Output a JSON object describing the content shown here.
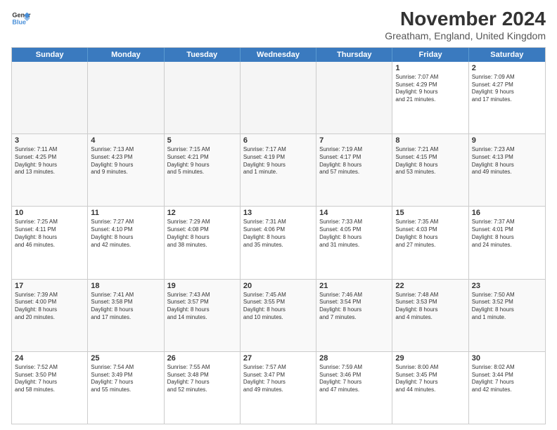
{
  "header": {
    "logo_line1": "General",
    "logo_line2": "Blue",
    "main_title": "November 2024",
    "subtitle": "Greatham, England, United Kingdom"
  },
  "weekdays": [
    "Sunday",
    "Monday",
    "Tuesday",
    "Wednesday",
    "Thursday",
    "Friday",
    "Saturday"
  ],
  "rows": [
    [
      {
        "day": "",
        "info": "",
        "empty": true
      },
      {
        "day": "",
        "info": "",
        "empty": true
      },
      {
        "day": "",
        "info": "",
        "empty": true
      },
      {
        "day": "",
        "info": "",
        "empty": true
      },
      {
        "day": "",
        "info": "",
        "empty": true
      },
      {
        "day": "1",
        "info": "Sunrise: 7:07 AM\nSunset: 4:29 PM\nDaylight: 9 hours\nand 21 minutes.",
        "empty": false
      },
      {
        "day": "2",
        "info": "Sunrise: 7:09 AM\nSunset: 4:27 PM\nDaylight: 9 hours\nand 17 minutes.",
        "empty": false
      }
    ],
    [
      {
        "day": "3",
        "info": "Sunrise: 7:11 AM\nSunset: 4:25 PM\nDaylight: 9 hours\nand 13 minutes.",
        "empty": false
      },
      {
        "day": "4",
        "info": "Sunrise: 7:13 AM\nSunset: 4:23 PM\nDaylight: 9 hours\nand 9 minutes.",
        "empty": false
      },
      {
        "day": "5",
        "info": "Sunrise: 7:15 AM\nSunset: 4:21 PM\nDaylight: 9 hours\nand 5 minutes.",
        "empty": false
      },
      {
        "day": "6",
        "info": "Sunrise: 7:17 AM\nSunset: 4:19 PM\nDaylight: 9 hours\nand 1 minute.",
        "empty": false
      },
      {
        "day": "7",
        "info": "Sunrise: 7:19 AM\nSunset: 4:17 PM\nDaylight: 8 hours\nand 57 minutes.",
        "empty": false
      },
      {
        "day": "8",
        "info": "Sunrise: 7:21 AM\nSunset: 4:15 PM\nDaylight: 8 hours\nand 53 minutes.",
        "empty": false
      },
      {
        "day": "9",
        "info": "Sunrise: 7:23 AM\nSunset: 4:13 PM\nDaylight: 8 hours\nand 49 minutes.",
        "empty": false
      }
    ],
    [
      {
        "day": "10",
        "info": "Sunrise: 7:25 AM\nSunset: 4:11 PM\nDaylight: 8 hours\nand 46 minutes.",
        "empty": false
      },
      {
        "day": "11",
        "info": "Sunrise: 7:27 AM\nSunset: 4:10 PM\nDaylight: 8 hours\nand 42 minutes.",
        "empty": false
      },
      {
        "day": "12",
        "info": "Sunrise: 7:29 AM\nSunset: 4:08 PM\nDaylight: 8 hours\nand 38 minutes.",
        "empty": false
      },
      {
        "day": "13",
        "info": "Sunrise: 7:31 AM\nSunset: 4:06 PM\nDaylight: 8 hours\nand 35 minutes.",
        "empty": false
      },
      {
        "day": "14",
        "info": "Sunrise: 7:33 AM\nSunset: 4:05 PM\nDaylight: 8 hours\nand 31 minutes.",
        "empty": false
      },
      {
        "day": "15",
        "info": "Sunrise: 7:35 AM\nSunset: 4:03 PM\nDaylight: 8 hours\nand 27 minutes.",
        "empty": false
      },
      {
        "day": "16",
        "info": "Sunrise: 7:37 AM\nSunset: 4:01 PM\nDaylight: 8 hours\nand 24 minutes.",
        "empty": false
      }
    ],
    [
      {
        "day": "17",
        "info": "Sunrise: 7:39 AM\nSunset: 4:00 PM\nDaylight: 8 hours\nand 20 minutes.",
        "empty": false
      },
      {
        "day": "18",
        "info": "Sunrise: 7:41 AM\nSunset: 3:58 PM\nDaylight: 8 hours\nand 17 minutes.",
        "empty": false
      },
      {
        "day": "19",
        "info": "Sunrise: 7:43 AM\nSunset: 3:57 PM\nDaylight: 8 hours\nand 14 minutes.",
        "empty": false
      },
      {
        "day": "20",
        "info": "Sunrise: 7:45 AM\nSunset: 3:55 PM\nDaylight: 8 hours\nand 10 minutes.",
        "empty": false
      },
      {
        "day": "21",
        "info": "Sunrise: 7:46 AM\nSunset: 3:54 PM\nDaylight: 8 hours\nand 7 minutes.",
        "empty": false
      },
      {
        "day": "22",
        "info": "Sunrise: 7:48 AM\nSunset: 3:53 PM\nDaylight: 8 hours\nand 4 minutes.",
        "empty": false
      },
      {
        "day": "23",
        "info": "Sunrise: 7:50 AM\nSunset: 3:52 PM\nDaylight: 8 hours\nand 1 minute.",
        "empty": false
      }
    ],
    [
      {
        "day": "24",
        "info": "Sunrise: 7:52 AM\nSunset: 3:50 PM\nDaylight: 7 hours\nand 58 minutes.",
        "empty": false
      },
      {
        "day": "25",
        "info": "Sunrise: 7:54 AM\nSunset: 3:49 PM\nDaylight: 7 hours\nand 55 minutes.",
        "empty": false
      },
      {
        "day": "26",
        "info": "Sunrise: 7:55 AM\nSunset: 3:48 PM\nDaylight: 7 hours\nand 52 minutes.",
        "empty": false
      },
      {
        "day": "27",
        "info": "Sunrise: 7:57 AM\nSunset: 3:47 PM\nDaylight: 7 hours\nand 49 minutes.",
        "empty": false
      },
      {
        "day": "28",
        "info": "Sunrise: 7:59 AM\nSunset: 3:46 PM\nDaylight: 7 hours\nand 47 minutes.",
        "empty": false
      },
      {
        "day": "29",
        "info": "Sunrise: 8:00 AM\nSunset: 3:45 PM\nDaylight: 7 hours\nand 44 minutes.",
        "empty": false
      },
      {
        "day": "30",
        "info": "Sunrise: 8:02 AM\nSunset: 3:44 PM\nDaylight: 7 hours\nand 42 minutes.",
        "empty": false
      }
    ]
  ]
}
